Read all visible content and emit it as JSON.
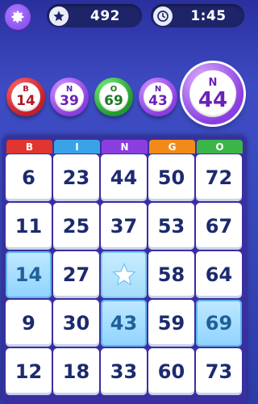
{
  "hud": {
    "score": "492",
    "timer": "1:45",
    "score_icon": "star-icon",
    "timer_icon": "clock-icon",
    "settings_icon": "gear-icon"
  },
  "called_balls": [
    {
      "letter": "B",
      "number": "14",
      "color": "#c41f2a"
    },
    {
      "letter": "N",
      "number": "39",
      "color": "#8a3ee0"
    },
    {
      "letter": "O",
      "number": "69",
      "color": "#1f9a2e"
    },
    {
      "letter": "N",
      "number": "43",
      "color": "#8a3ee0"
    }
  ],
  "current_ball": {
    "letter": "N",
    "number": "44",
    "color": "#8a3ee0"
  },
  "card": {
    "headers": [
      {
        "label": "B",
        "color": "#e0362f"
      },
      {
        "label": "I",
        "color": "#3aa3e8"
      },
      {
        "label": "N",
        "color": "#8a3ee0"
      },
      {
        "label": "G",
        "color": "#f28a1a"
      },
      {
        "label": "O",
        "color": "#3bb54a"
      }
    ],
    "rows": [
      [
        "6",
        "23",
        "44",
        "50",
        "72"
      ],
      [
        "11",
        "25",
        "37",
        "53",
        "67"
      ],
      [
        "14",
        "27",
        "",
        "58",
        "64"
      ],
      [
        "9",
        "30",
        "43",
        "59",
        "69"
      ],
      [
        "12",
        "18",
        "33",
        "60",
        "73"
      ]
    ],
    "daubed": [
      "14",
      "43",
      "69"
    ],
    "free_icon": "star-icon"
  }
}
